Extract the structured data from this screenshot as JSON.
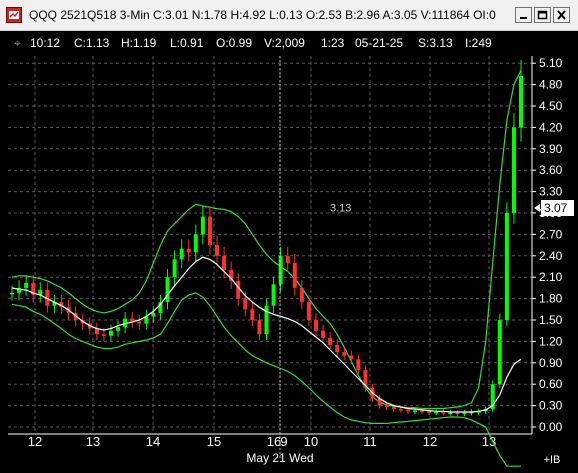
{
  "window": {
    "title": "QQQ 2521Q518 3-Min C:3.01 N:1.78 H:4.92 L:0.13 O:2.53 B:2.96 A:3.05 V:111864 OI:0",
    "icon": "chart-app-icon",
    "minimize_icon": "minimize-icon",
    "maximize_icon": "maximize-icon",
    "close_icon": "close-icon"
  },
  "infobar": {
    "time": "10:12",
    "close": "C:1.13",
    "high": "H:1.19",
    "low": "L:0.91",
    "open": "O:0.99",
    "volume": "V:2,009",
    "ratio": "1:23",
    "date": "05-21-25",
    "strike": "S:3.13",
    "bar_index": "I:249"
  },
  "cursor_value_label": "3.13",
  "last_price_marker": "3.07",
  "x_axis": {
    "ticks": [
      "12",
      "13",
      "14",
      "15",
      "16",
      "9",
      "10",
      "11",
      "12",
      "13"
    ],
    "date_label": "May 21 Wed",
    "corner_label": "+IB"
  },
  "colors": {
    "background": "#000000",
    "candle_up": "#00ff00",
    "candle_down": "#ff3030",
    "bands": "#33dd33",
    "moving_average": "#ffffff",
    "grid": "#5a5a5a",
    "axis_text": "#ffffff"
  },
  "chart_data": {
    "type": "line",
    "ylim": [
      0.0,
      5.1
    ],
    "y_ticks": [
      "0.00",
      "0.30",
      "0.60",
      "0.90",
      "1.20",
      "1.50",
      "1.80",
      "2.10",
      "2.40",
      "2.70",
      "3.00",
      "3.30",
      "3.60",
      "3.90",
      "4.20",
      "4.50",
      "4.80",
      "5.10"
    ],
    "x_tick_labels": [
      "12",
      "13",
      "14",
      "15",
      "16",
      "9",
      "10",
      "11",
      "12",
      "13"
    ],
    "series": [
      {
        "role": "price",
        "values": [
          1.88,
          1.95,
          2.02,
          1.85,
          1.92,
          1.7,
          1.75,
          1.68,
          1.6,
          1.5,
          1.45,
          1.38,
          1.3,
          1.28,
          1.35,
          1.4,
          1.52,
          1.48,
          1.45,
          1.55,
          1.6,
          1.75,
          2.1,
          2.35,
          2.5,
          2.45,
          2.7,
          2.95,
          2.55,
          2.4,
          2.2,
          2.05,
          1.8,
          1.65,
          1.5,
          1.3,
          1.7,
          2.0,
          2.4,
          2.3,
          1.95,
          1.75,
          1.5,
          1.35,
          1.25,
          1.15,
          1.05,
          1.0,
          0.95,
          0.8,
          0.55,
          0.4,
          0.3,
          0.28,
          0.25,
          0.24,
          0.22,
          0.23,
          0.22,
          0.2,
          0.21,
          0.2,
          0.2,
          0.19,
          0.2,
          0.21,
          0.22,
          0.25,
          0.6,
          1.5,
          3.0,
          4.2,
          4.92
        ]
      },
      {
        "role": "average",
        "values": [
          1.95,
          1.93,
          1.92,
          1.88,
          1.85,
          1.8,
          1.75,
          1.7,
          1.64,
          1.56,
          1.48,
          1.42,
          1.38,
          1.36,
          1.38,
          1.42,
          1.45,
          1.47,
          1.5,
          1.55,
          1.62,
          1.72,
          1.85,
          1.98,
          2.1,
          2.22,
          2.32,
          2.38,
          2.35,
          2.28,
          2.18,
          2.08,
          1.96,
          1.84,
          1.75,
          1.68,
          1.62,
          1.58,
          1.55,
          1.52,
          1.48,
          1.42,
          1.34,
          1.26,
          1.18,
          1.08,
          0.98,
          0.88,
          0.78,
          0.68,
          0.58,
          0.48,
          0.4,
          0.34,
          0.3,
          0.28,
          0.26,
          0.25,
          0.24,
          0.23,
          0.22,
          0.22,
          0.21,
          0.21,
          0.21,
          0.21,
          0.22,
          0.24,
          0.3,
          0.45,
          0.7,
          0.88,
          0.95
        ]
      },
      {
        "role": "upper band",
        "values": [
          2.1,
          2.12,
          2.12,
          2.1,
          2.08,
          2.05,
          2.0,
          1.95,
          1.88,
          1.8,
          1.72,
          1.66,
          1.62,
          1.6,
          1.62,
          1.66,
          1.72,
          1.78,
          1.88,
          2.05,
          2.3,
          2.55,
          2.75,
          2.85,
          2.95,
          3.05,
          3.12,
          3.1,
          3.08,
          3.06,
          3.05,
          3.02,
          2.95,
          2.85,
          2.7,
          2.55,
          2.42,
          2.32,
          2.25,
          2.18,
          2.08,
          1.95,
          1.8,
          1.66,
          1.55,
          1.45,
          1.3,
          1.12,
          0.92,
          0.72,
          0.55,
          0.42,
          0.35,
          0.31,
          0.29,
          0.28,
          0.27,
          0.27,
          0.26,
          0.26,
          0.26,
          0.26,
          0.27,
          0.28,
          0.3,
          0.34,
          0.55,
          1.2,
          2.3,
          3.4,
          4.3,
          4.8,
          5.0
        ]
      },
      {
        "role": "lower band",
        "values": [
          1.72,
          1.7,
          1.68,
          1.62,
          1.58,
          1.52,
          1.45,
          1.38,
          1.3,
          1.24,
          1.2,
          1.16,
          1.12,
          1.1,
          1.1,
          1.12,
          1.16,
          1.18,
          1.2,
          1.22,
          1.25,
          1.3,
          1.45,
          1.62,
          1.78,
          1.85,
          1.88,
          1.82,
          1.7,
          1.55,
          1.4,
          1.28,
          1.18,
          1.08,
          1.0,
          0.95,
          0.9,
          0.86,
          0.82,
          0.78,
          0.72,
          0.64,
          0.55,
          0.45,
          0.36,
          0.28,
          0.2,
          0.14,
          0.1,
          0.08,
          0.06,
          0.05,
          0.05,
          0.05,
          0.06,
          0.07,
          0.08,
          0.09,
          0.1,
          0.11,
          0.12,
          0.13,
          0.14,
          0.14,
          0.13,
          0.1,
          0.05,
          0.0,
          -0.2,
          -0.4,
          -0.55,
          -0.55,
          -0.55
        ]
      }
    ]
  }
}
